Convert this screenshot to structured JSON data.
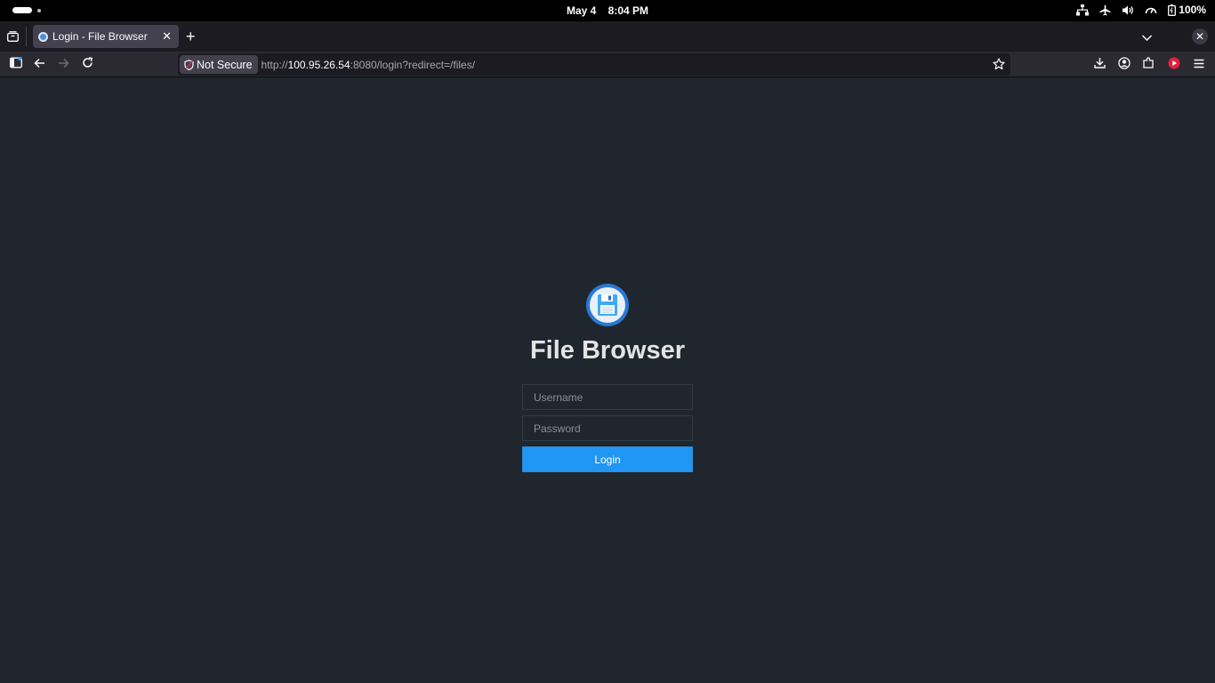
{
  "system_bar": {
    "date": "May 4",
    "time": "8:04 PM",
    "battery": "100%"
  },
  "browser": {
    "tab": {
      "title": "Login - File Browser"
    },
    "address": {
      "security_label": "Not Secure",
      "scheme": "http://",
      "host": "100.95.26.54",
      "rest": ":8080/login?redirect=/files/"
    }
  },
  "login": {
    "title": "File Browser",
    "username_placeholder": "Username",
    "password_placeholder": "Password",
    "submit_label": "Login"
  },
  "colors": {
    "page_background": "#20262e",
    "accent": "#2196f3"
  }
}
